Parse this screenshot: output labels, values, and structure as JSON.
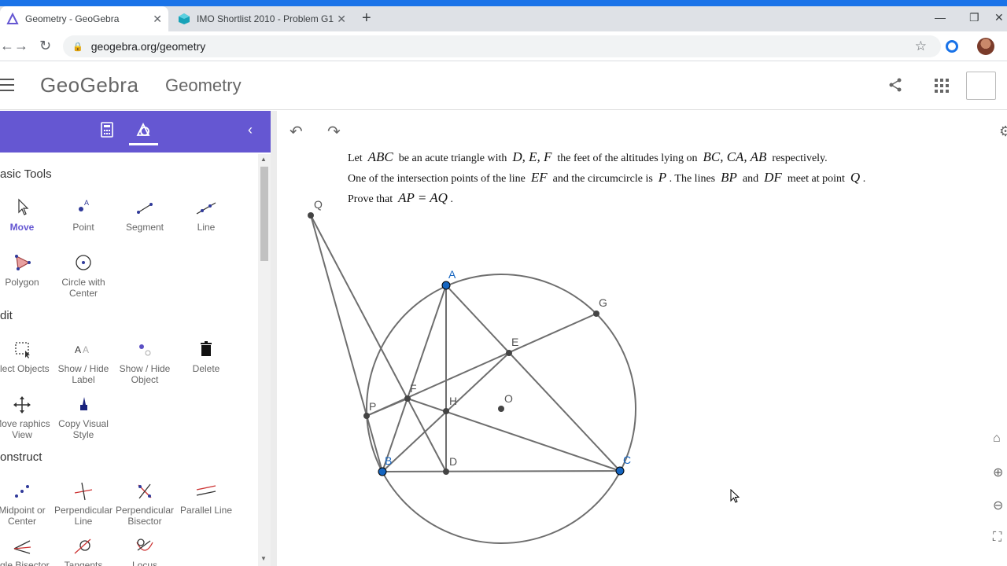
{
  "browser": {
    "tabs": [
      {
        "title": "Geometry - GeoGebra",
        "active": true
      },
      {
        "title": "IMO Shortlist 2010 - Problem G1",
        "active": false
      }
    ],
    "url": "geogebra.org/geometry",
    "new_tab": "+",
    "close": "✕",
    "window_controls": {
      "minimize": "—",
      "restore": "❐",
      "close": "✕"
    }
  },
  "app": {
    "brand": "GeoGebra",
    "name": "Geometry"
  },
  "toolbar": {
    "groups": [
      {
        "title": "asic Tools",
        "tools": [
          {
            "label": "Move",
            "icon": "move-arrow-icon"
          },
          {
            "label": "Point",
            "icon": "point-icon"
          },
          {
            "label": "Segment",
            "icon": "segment-icon"
          },
          {
            "label": "Line",
            "icon": "line-icon"
          },
          {
            "label": "Polygon",
            "icon": "polygon-icon"
          },
          {
            "label": "Circle with Center",
            "icon": "circle-center-icon"
          }
        ]
      },
      {
        "title": "dit",
        "tools": [
          {
            "label": "elect Objects",
            "icon": "select-objects-icon"
          },
          {
            "label": "Show / Hide Label",
            "icon": "show-hide-label-icon"
          },
          {
            "label": "Show / Hide Object",
            "icon": "show-hide-object-icon"
          },
          {
            "label": "Delete",
            "icon": "delete-icon"
          },
          {
            "label": "Move raphics View",
            "icon": "move-graphics-icon"
          },
          {
            "label": "Copy Visual Style",
            "icon": "copy-style-icon"
          }
        ]
      },
      {
        "title": "onstruct",
        "tools": [
          {
            "label": "Midpoint or Center",
            "icon": "midpoint-icon"
          },
          {
            "label": "Perpendicular Line",
            "icon": "perpendicular-line-icon"
          },
          {
            "label": "Perpendicular Bisector",
            "icon": "perpendicular-bisector-icon"
          },
          {
            "label": "Parallel Line",
            "icon": "parallel-line-icon"
          },
          {
            "label": "ngle Bisector",
            "icon": "angle-bisector-icon"
          },
          {
            "label": "Tangents",
            "icon": "tangents-icon"
          },
          {
            "label": "Locus",
            "icon": "locus-icon"
          }
        ]
      }
    ]
  },
  "problem": {
    "l1a": "Let",
    "l1b": "ABC",
    "l1c": "be an acute triangle with",
    "l1d": "D, E, F",
    "l1e": "the feet of the altitudes lying on",
    "l1f": "BC, CA, AB",
    "l1g": "respectively.",
    "l2a": "One of the intersection points of the line",
    "l2b": "EF",
    "l2c": "and the circumcircle is",
    "l2d": "P",
    "l2e": ". The lines",
    "l2f": "BP",
    "l2g": "and",
    "l2h": "DF",
    "l2i": "meet at point",
    "l2j": "Q",
    "l2k": ".",
    "l3a": "Prove that",
    "l3b": "AP = AQ",
    "l3c": "."
  },
  "geometry": {
    "point_labels": [
      "Q",
      "A",
      "G",
      "E",
      "F",
      "H",
      "O",
      "P",
      "B",
      "D",
      "C"
    ],
    "colors": {
      "free_point": "#1565c0",
      "dependent_point": "#444444",
      "segment": "#6e6e6e",
      "accent": "#6557d2"
    }
  }
}
